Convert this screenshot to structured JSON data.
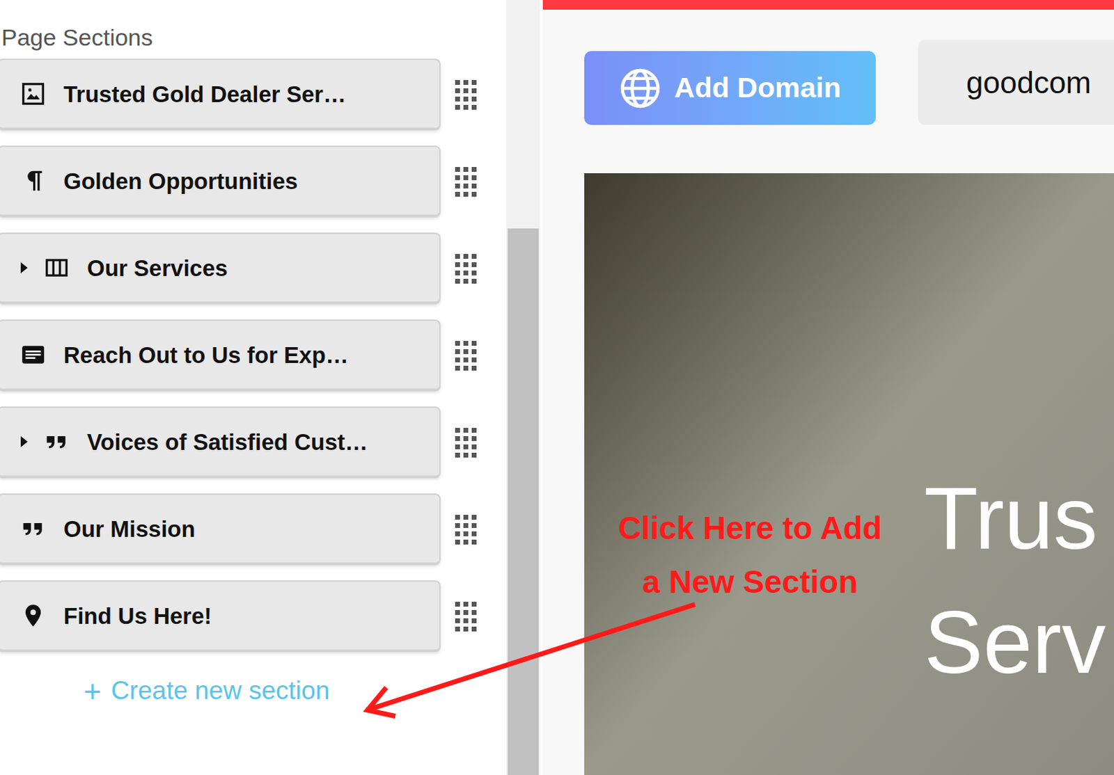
{
  "sidebar": {
    "title": "Page Sections",
    "sections": [
      {
        "title": "Trusted Gold Dealer Ser…",
        "kind": "image",
        "collapsible": false,
        "expanded": false
      },
      {
        "title": "Golden Opportunities",
        "kind": "paragraph",
        "collapsible": false,
        "expanded": false
      },
      {
        "title": "Our Services",
        "kind": "columns",
        "collapsible": true,
        "expanded": false
      },
      {
        "title": "Reach Out to Us for Exp…",
        "kind": "form",
        "collapsible": false,
        "expanded": false
      },
      {
        "title": "Voices of Satisfied Cust…",
        "kind": "quote",
        "collapsible": true,
        "expanded": false
      },
      {
        "title": "Our Mission",
        "kind": "quote",
        "collapsible": false,
        "expanded": false
      },
      {
        "title": "Find Us Here!",
        "kind": "map",
        "collapsible": false,
        "expanded": false
      }
    ],
    "create_button": {
      "icon": "+",
      "label": "Create new section"
    }
  },
  "toolbar": {
    "add_domain": "Add Domain",
    "domain": "goodcom"
  },
  "hero": {
    "lines": [
      "Trus",
      "Serv"
    ]
  },
  "annotation": {
    "lines": [
      "Click Here to Add",
      "a New Section"
    ]
  }
}
